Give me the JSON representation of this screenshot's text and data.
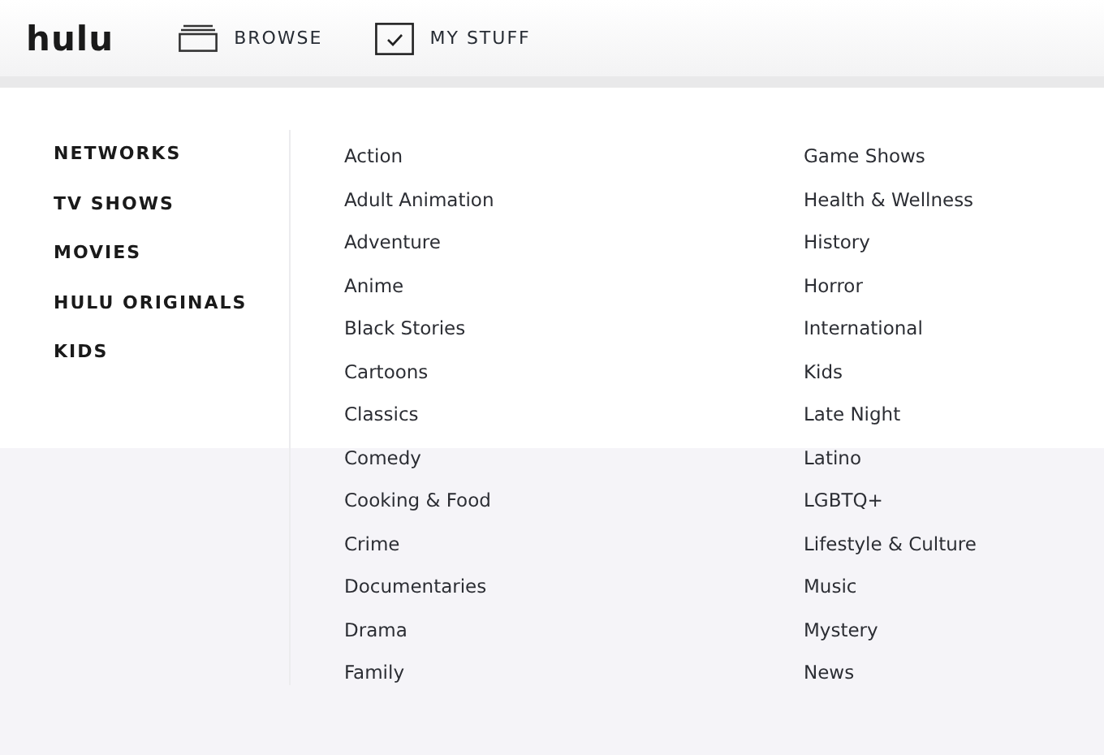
{
  "header": {
    "logo": "hulu",
    "nav": [
      {
        "kind": "browse",
        "label": "BROWSE"
      },
      {
        "kind": "mystuff",
        "label": "MY STUFF"
      }
    ]
  },
  "menu": {
    "sections": [
      {
        "label": "NETWORKS"
      },
      {
        "label": "TV SHOWS"
      },
      {
        "label": "MOVIES"
      },
      {
        "label": "HULU ORIGINALS"
      },
      {
        "label": "KIDS"
      }
    ],
    "genres_column_1": [
      "Action",
      "Adult Animation",
      "Adventure",
      "Anime",
      "Black Stories",
      "Cartoons",
      "Classics",
      "Comedy",
      "Cooking & Food",
      "Crime",
      "Documentaries",
      "Drama",
      "Family"
    ],
    "genres_column_2": [
      "Game Shows",
      "Health & Wellness",
      "History",
      "Horror",
      "International",
      "Kids",
      "Late Night",
      "Latino",
      "LGBTQ+",
      "Lifestyle & Culture",
      "Music",
      "Mystery",
      "News"
    ]
  }
}
